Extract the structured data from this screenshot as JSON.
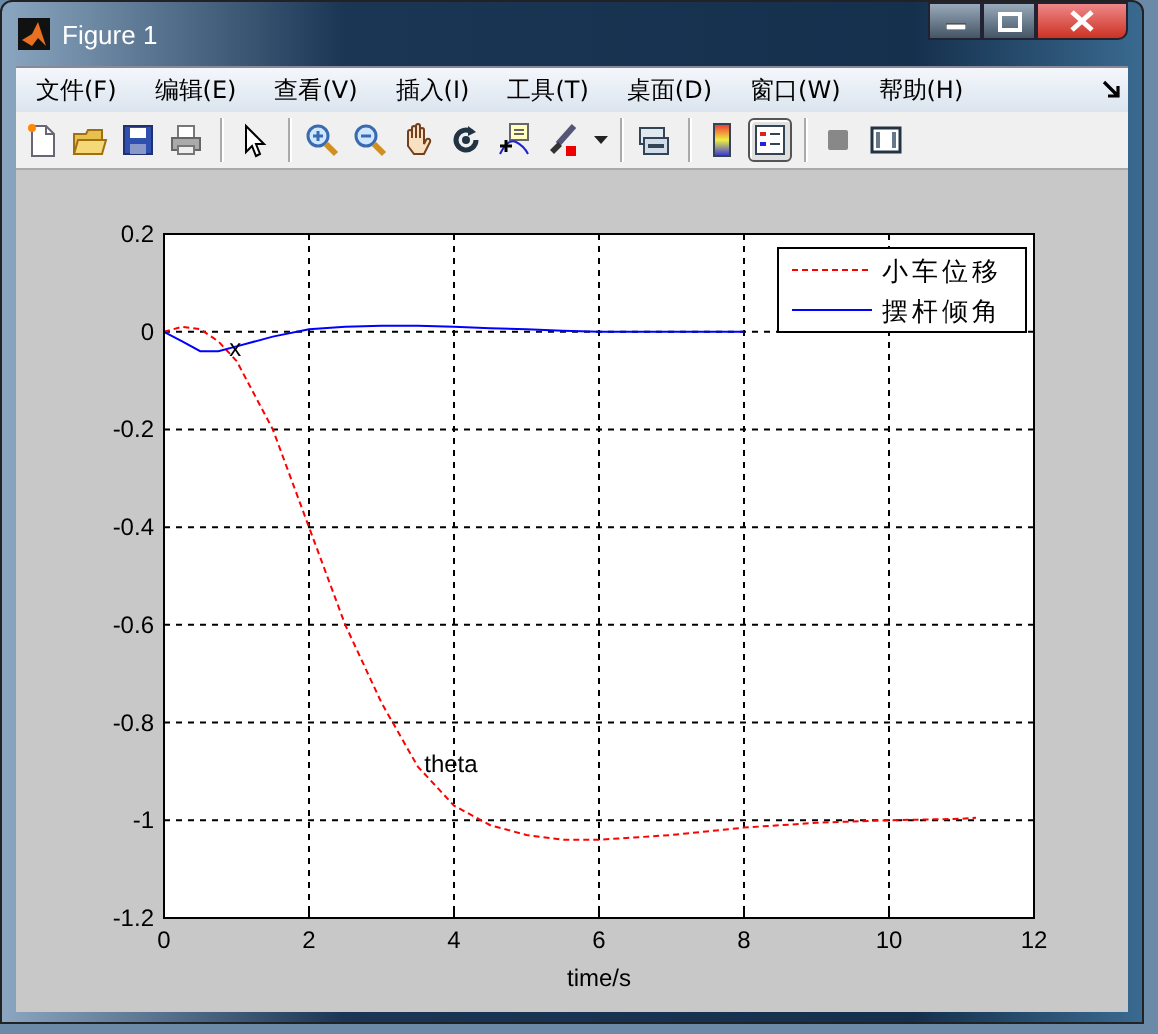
{
  "window": {
    "title": "Figure 1"
  },
  "menu": [
    "文件(F)",
    "编辑(E)",
    "查看(V)",
    "插入(I)",
    "工具(T)",
    "桌面(D)",
    "窗口(W)",
    "帮助(H)"
  ],
  "toolbar": [
    {
      "kind": "new",
      "pressed": false
    },
    {
      "kind": "open",
      "pressed": false
    },
    {
      "kind": "save",
      "pressed": false
    },
    {
      "kind": "print",
      "pressed": false
    },
    {
      "kind": "sep"
    },
    {
      "kind": "pointer",
      "pressed": false
    },
    {
      "kind": "sep"
    },
    {
      "kind": "zoom-in",
      "pressed": false
    },
    {
      "kind": "zoom-out",
      "pressed": false
    },
    {
      "kind": "pan",
      "pressed": false
    },
    {
      "kind": "rotate",
      "pressed": false
    },
    {
      "kind": "data-cursor",
      "pressed": false
    },
    {
      "kind": "brush",
      "pressed": false
    },
    {
      "kind": "caret"
    },
    {
      "kind": "sep"
    },
    {
      "kind": "link",
      "pressed": false
    },
    {
      "kind": "sep"
    },
    {
      "kind": "colorbar",
      "pressed": false
    },
    {
      "kind": "legend",
      "pressed": true
    },
    {
      "kind": "sep"
    },
    {
      "kind": "hide-tools",
      "pressed": false
    },
    {
      "kind": "show-tools",
      "pressed": false
    }
  ],
  "chart_data": {
    "type": "line",
    "xlabel": "time/s",
    "x": [
      0,
      0.25,
      0.5,
      0.75,
      1,
      1.5,
      2,
      2.5,
      3,
      3.5,
      4,
      4.5,
      5,
      5.5,
      6,
      7,
      8,
      9,
      10,
      11,
      11.2
    ],
    "series": [
      {
        "name": "小车位移",
        "color": "#ff0000",
        "line_style": "dashed",
        "values": [
          0,
          0.01,
          0.005,
          -0.02,
          -0.06,
          -0.2,
          -0.4,
          -0.6,
          -0.76,
          -0.89,
          -0.97,
          -1.01,
          -1.03,
          -1.04,
          -1.04,
          -1.03,
          -1.015,
          -1.005,
          -1.0,
          -0.997,
          -0.995
        ]
      },
      {
        "name": "摆杆倾角",
        "color": "#0000ff",
        "line_style": "solid",
        "values": [
          0,
          -0.02,
          -0.04,
          -0.04,
          -0.03,
          -0.01,
          0.005,
          0.01,
          0.012,
          0.012,
          0.01,
          0.007,
          0.005,
          0.002,
          0,
          0,
          0,
          null,
          null,
          null,
          null
        ]
      }
    ],
    "grid": true,
    "legend": "upper right",
    "xlim": [
      0,
      12
    ],
    "ylim": [
      -1.2,
      0.2
    ],
    "xticks": [
      0,
      2,
      4,
      6,
      8,
      10,
      12
    ],
    "yticks": [
      -1.2,
      -1,
      -0.8,
      -0.6,
      -0.4,
      -0.2,
      0,
      0.2
    ],
    "annotations": [
      {
        "text": "x",
        "x": 0.9,
        "y": -0.034
      },
      {
        "text": "theta",
        "x": 3.59,
        "y": -0.885
      }
    ]
  }
}
